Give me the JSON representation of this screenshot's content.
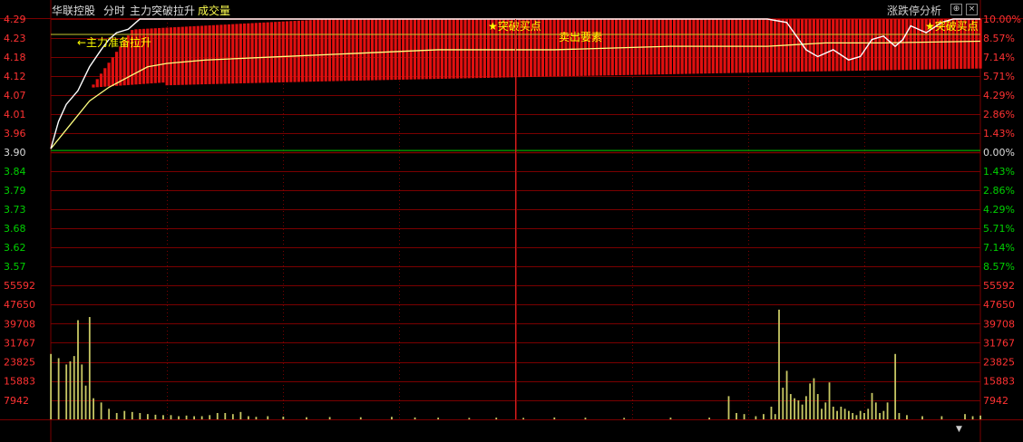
{
  "header": {
    "stock_name": "华联控股",
    "tab_time": "分时",
    "indicator_name": "主力突破拉升",
    "volume_label": "成交量",
    "panel_title": "涨跌停分析",
    "btn_up": "⊕",
    "btn_close": "×"
  },
  "colors": {
    "up": "#ff3232",
    "down": "#00d000",
    "grid": "#7a0000",
    "price_line": "#ffffff",
    "avg_line": "#ffff80",
    "bar_red": "#e01010",
    "volume": "#c8c864",
    "annotation": "#ffff00"
  },
  "annotations": {
    "main_prepare": "←主力准备拉升",
    "breakout_1": "★突破买点",
    "sell_1": "卖出要素",
    "breakout_2": "★突破买点"
  },
  "chart_data": {
    "type": "line",
    "prev_close": 3.9,
    "limit_up": 4.29,
    "price_axis_left": [
      "4.29",
      "4.23",
      "4.18",
      "4.12",
      "4.07",
      "4.01",
      "3.96",
      "3.90",
      "3.84",
      "3.79",
      "3.73",
      "3.68",
      "3.62",
      "3.57"
    ],
    "pct_axis_right": [
      "10.00%",
      "8.57%",
      "7.14%",
      "5.71%",
      "4.29%",
      "2.86%",
      "1.43%",
      "0.00%",
      "1.43%",
      "2.86%",
      "4.29%",
      "5.71%",
      "7.14%",
      "8.57%"
    ],
    "volume_axis": [
      "55592",
      "47650",
      "39708",
      "31767",
      "23825",
      "15883",
      "7942"
    ],
    "volume_max": 63534,
    "price_points": [
      [
        0,
        3.91
      ],
      [
        2,
        3.99
      ],
      [
        4,
        4.04
      ],
      [
        7,
        4.08
      ],
      [
        10,
        4.15
      ],
      [
        13,
        4.2
      ],
      [
        15,
        4.23
      ],
      [
        17,
        4.25
      ],
      [
        20,
        4.26
      ],
      [
        23,
        4.29
      ],
      [
        60,
        4.29
      ],
      [
        120,
        4.29
      ],
      [
        185,
        4.29
      ],
      [
        190,
        4.28
      ],
      [
        195,
        4.2
      ],
      [
        198,
        4.18
      ],
      [
        202,
        4.2
      ],
      [
        206,
        4.17
      ],
      [
        209,
        4.18
      ],
      [
        212,
        4.23
      ],
      [
        215,
        4.24
      ],
      [
        218,
        4.21
      ],
      [
        220,
        4.23
      ],
      [
        222,
        4.27
      ],
      [
        226,
        4.25
      ],
      [
        230,
        4.28
      ],
      [
        233,
        4.29
      ],
      [
        240,
        4.29
      ]
    ],
    "avg_points": [
      [
        0,
        3.91
      ],
      [
        5,
        3.98
      ],
      [
        10,
        4.05
      ],
      [
        15,
        4.09
      ],
      [
        20,
        4.12
      ],
      [
        25,
        4.15
      ],
      [
        30,
        4.16
      ],
      [
        40,
        4.17
      ],
      [
        60,
        4.18
      ],
      [
        80,
        4.19
      ],
      [
        100,
        4.2
      ],
      [
        130,
        4.2
      ],
      [
        160,
        4.21
      ],
      [
        185,
        4.21
      ],
      [
        200,
        4.22
      ],
      [
        215,
        4.22
      ],
      [
        240,
        4.225
      ]
    ],
    "bars_start": 4.087,
    "bars_end": 4.145,
    "bars_start_minute": 8,
    "yellow_line": 4.245,
    "green_line": 3.905,
    "volume": [
      [
        0,
        31000
      ],
      [
        2,
        29000
      ],
      [
        4,
        26000
      ],
      [
        5,
        27500
      ],
      [
        6,
        30000
      ],
      [
        7,
        47000
      ],
      [
        8,
        26000
      ],
      [
        9,
        16000
      ],
      [
        10,
        48500
      ],
      [
        11,
        10000
      ],
      [
        13,
        8000
      ],
      [
        15,
        5000
      ],
      [
        17,
        3000
      ],
      [
        19,
        4000
      ],
      [
        21,
        3500
      ],
      [
        23,
        3000
      ],
      [
        25,
        2500
      ],
      [
        27,
        2200
      ],
      [
        29,
        2000
      ],
      [
        31,
        2000
      ],
      [
        33,
        1500
      ],
      [
        35,
        1800
      ],
      [
        37,
        1500
      ],
      [
        39,
        1500
      ],
      [
        41,
        2000
      ],
      [
        43,
        3000
      ],
      [
        45,
        3000
      ],
      [
        47,
        2500
      ],
      [
        49,
        3500
      ],
      [
        51,
        1500
      ],
      [
        53,
        1200
      ],
      [
        56,
        1500
      ],
      [
        60,
        1300
      ],
      [
        66,
        1000
      ],
      [
        72,
        1100
      ],
      [
        80,
        1000
      ],
      [
        88,
        1200
      ],
      [
        94,
        900
      ],
      [
        100,
        800
      ],
      [
        108,
        700
      ],
      [
        115,
        800
      ],
      [
        122,
        700
      ],
      [
        130,
        900
      ],
      [
        138,
        800
      ],
      [
        148,
        700
      ],
      [
        160,
        800
      ],
      [
        170,
        800
      ],
      [
        175,
        11000
      ],
      [
        177,
        3000
      ],
      [
        179,
        2500
      ],
      [
        182,
        1500
      ],
      [
        184,
        2500
      ],
      [
        186,
        6000
      ],
      [
        187,
        2500
      ],
      [
        188,
        52000
      ],
      [
        189,
        15000
      ],
      [
        190,
        23000
      ],
      [
        191,
        12000
      ],
      [
        192,
        10000
      ],
      [
        193,
        9000
      ],
      [
        194,
        7000
      ],
      [
        195,
        11000
      ],
      [
        196,
        17000
      ],
      [
        197,
        19500
      ],
      [
        198,
        12000
      ],
      [
        199,
        5000
      ],
      [
        200,
        8000
      ],
      [
        201,
        17500
      ],
      [
        202,
        6000
      ],
      [
        203,
        4000
      ],
      [
        204,
        6000
      ],
      [
        205,
        5000
      ],
      [
        206,
        4000
      ],
      [
        207,
        3000
      ],
      [
        208,
        2000
      ],
      [
        209,
        4000
      ],
      [
        210,
        3000
      ],
      [
        211,
        5000
      ],
      [
        212,
        12500
      ],
      [
        213,
        8000
      ],
      [
        214,
        3000
      ],
      [
        215,
        4000
      ],
      [
        216,
        8000
      ],
      [
        218,
        31000
      ],
      [
        219,
        3000
      ],
      [
        221,
        2000
      ],
      [
        225,
        1500
      ],
      [
        230,
        1500
      ],
      [
        236,
        2500
      ],
      [
        238,
        1500
      ],
      [
        240,
        1800
      ]
    ]
  }
}
